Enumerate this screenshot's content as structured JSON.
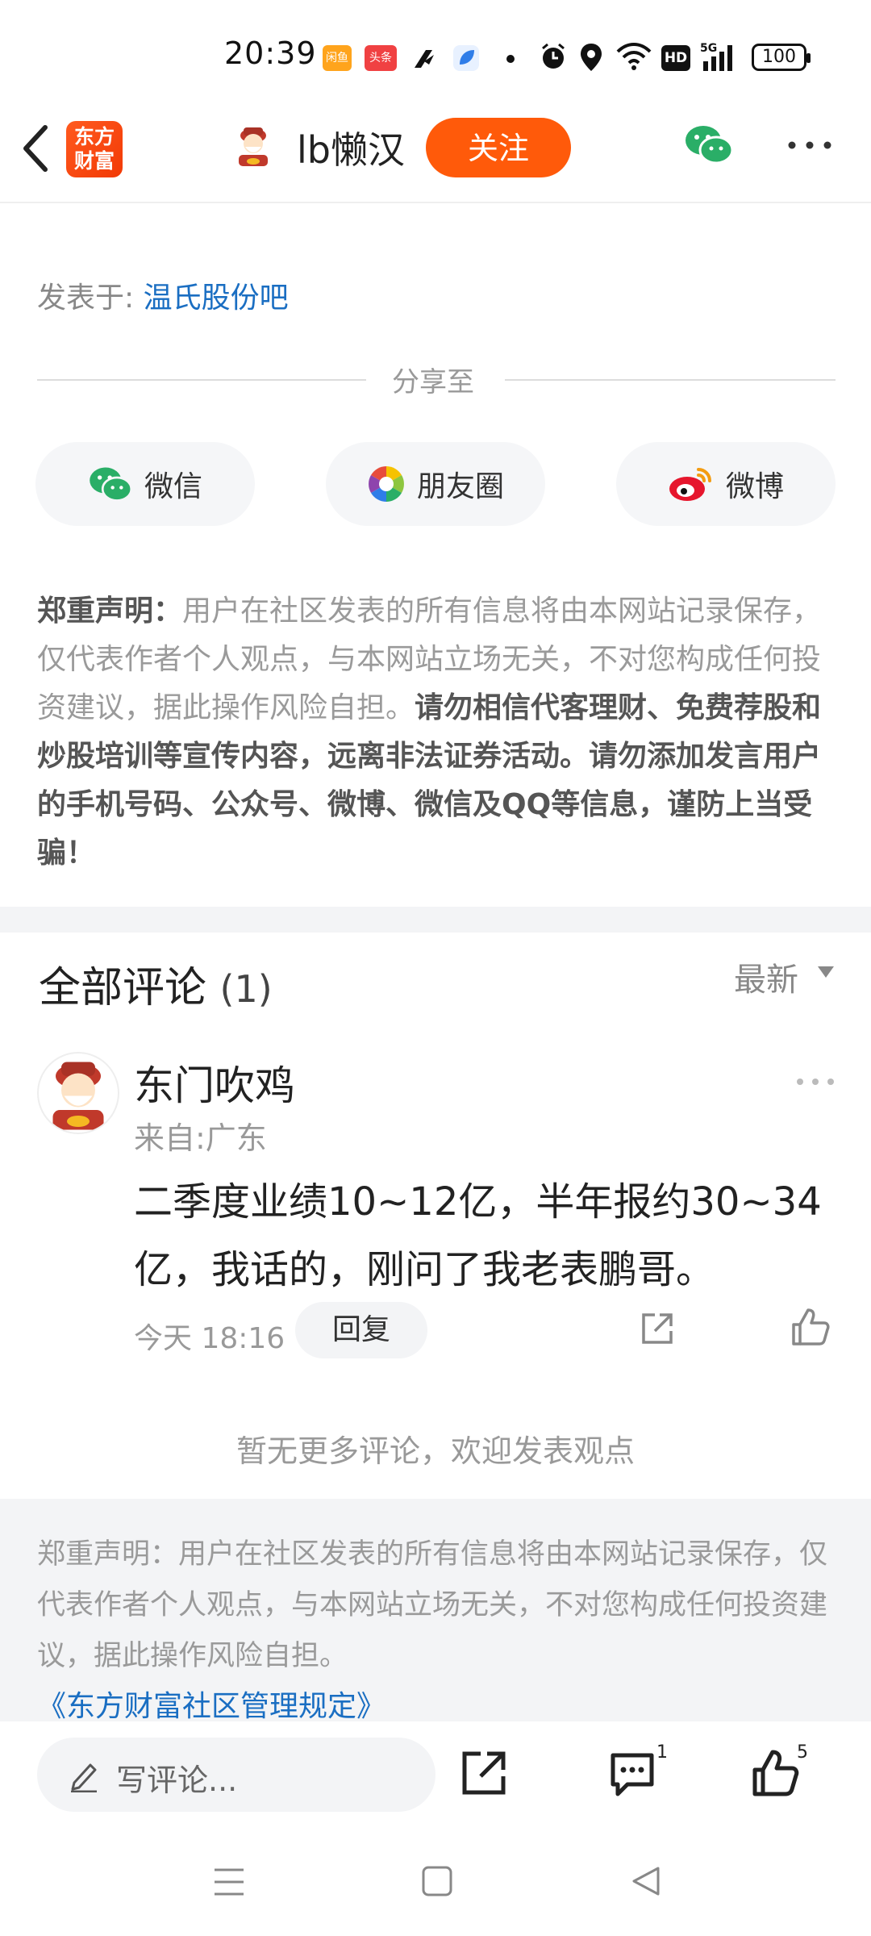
{
  "status_bar": {
    "time": "20:39",
    "battery": "100",
    "app_icon_1": "闲鱼",
    "app_icon_2": "头条"
  },
  "header": {
    "username": "lb懒汉",
    "follow_label": "关注",
    "logo_line1": "东方",
    "logo_line2": "财富"
  },
  "post": {
    "posted_label": "发表于: ",
    "bar_name": "温氏股份吧"
  },
  "share": {
    "title": "分享至",
    "items": [
      {
        "label": "微信",
        "icon": "wechat-icon"
      },
      {
        "label": "朋友圈",
        "icon": "moments-icon"
      },
      {
        "label": "微博",
        "icon": "weibo-icon"
      }
    ]
  },
  "disclaimer": {
    "lead": "郑重声明：",
    "normal": "用户在社区发表的所有信息将由本网站记录保存，仅代表作者个人观点，与本网站立场无关，不对您构成任何投资建议，据此操作风险自担。",
    "bold": "请勿相信代客理财、免费荐股和炒股培训等宣传内容，远离非法证券活动。请勿添加发言用户的手机号码、公众号、微博、微信及QQ等信息，谨防上当受骗！"
  },
  "comments": {
    "title": "全部评论",
    "count": "(1)",
    "sort_label": "最新",
    "items": [
      {
        "name": "东门吹鸡",
        "location": "来自:广东",
        "text": "二季度业绩10~12亿，半年报约30~34亿，我话的，刚问了我老表鹏哥。",
        "time": "今天 18:16",
        "reply_label": "回复"
      }
    ],
    "no_more": "暂无更多评论，欢迎发表观点"
  },
  "footer": {
    "disclaimer": "郑重声明：用户在社区发表的所有信息将由本网站记录保存，仅代表作者个人观点，与本网站立场无关，不对您构成任何投资建议，据此操作风险自担。",
    "rules_link": "《东方财富社区管理规定》"
  },
  "bottom_bar": {
    "comment_placeholder": "写评论...",
    "comment_count": "1",
    "like_count": "5"
  },
  "colors": {
    "accent": "#ff5a0a",
    "link": "#1a6ec2",
    "wechat": "#2aae67",
    "weibo": "#e6162d"
  }
}
